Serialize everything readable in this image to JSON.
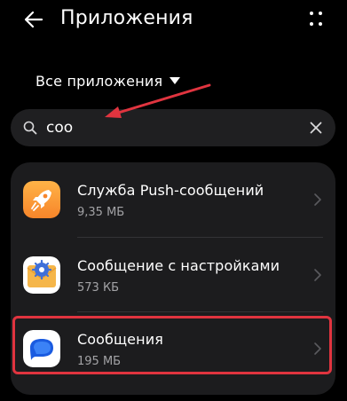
{
  "header": {
    "title": "Приложения",
    "back_icon": "arrow-left-icon",
    "more_icon": "more-vertical-icon"
  },
  "filter": {
    "label": "Все приложения",
    "icon": "triangle-down-icon"
  },
  "search": {
    "value": "соо",
    "icon": "search-icon",
    "clear_icon": "close-icon"
  },
  "apps": [
    {
      "name": "Служба Push-сообщений",
      "size": "9,35 МБ",
      "icon": "rocket-icon",
      "icon_color": "#fb9a2b"
    },
    {
      "name": "Сообщение с настройками",
      "size": "573 КБ",
      "icon": "envelope-gear-icon",
      "icon_color": "#f5b64a"
    },
    {
      "name": "Сообщения",
      "size": "195 МБ",
      "icon": "chat-bubble-icon",
      "icon_color": "#2e6ff0"
    }
  ],
  "colors": {
    "background": "#000000",
    "card": "#1c1c1e",
    "search_bg": "#1f1f21",
    "secondary_text": "#a3a3a6",
    "annotation": "#e0343f"
  }
}
